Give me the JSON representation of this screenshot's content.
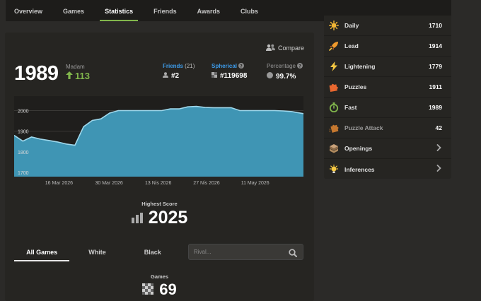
{
  "nav": {
    "tabs": [
      {
        "label": "Overview"
      },
      {
        "label": "Games"
      },
      {
        "label": "Statistics"
      },
      {
        "label": "Friends"
      },
      {
        "label": "Awards"
      },
      {
        "label": "Clubs"
      }
    ],
    "active": "Statistics"
  },
  "summary": {
    "compare_label": "Compare",
    "rating": "1989",
    "title_label": "Madam",
    "delta": "113",
    "friends_label": "Friends",
    "friends_count": "(21)",
    "friends_rank": "#2",
    "global_label": "Spherical",
    "global_rank": "#119698",
    "percentile_label": "Percentage",
    "percentile": "99.7%"
  },
  "chart_data": {
    "type": "area",
    "x_tick_labels": [
      "16 Mar 2026",
      "30 Mar 2026",
      "13 Nis 2026",
      "27 Nis 2026",
      "11 May 2026"
    ],
    "y_tick_labels": [
      "2000",
      "1900",
      "1800",
      "1700"
    ],
    "ylim": [
      1680,
      2070
    ],
    "grid": true,
    "color": "#3f95b4",
    "x": [
      0,
      3,
      6,
      9,
      12,
      15,
      18,
      21,
      24,
      27,
      30,
      33,
      36,
      39,
      42,
      45,
      48,
      51,
      54,
      57,
      60,
      63,
      66,
      69,
      72,
      75,
      78,
      81,
      84,
      87,
      90,
      93,
      96,
      100
    ],
    "values": [
      1880,
      1852,
      1872,
      1862,
      1855,
      1848,
      1838,
      1832,
      1922,
      1952,
      1960,
      1988,
      2000,
      2000,
      2000,
      2000,
      2000,
      2000,
      2008,
      2008,
      2018,
      2020,
      2015,
      2014,
      2014,
      2014,
      2000,
      2000,
      2000,
      2000,
      2000,
      1998,
      1995,
      1985
    ]
  },
  "highest": {
    "label": "Highest Score",
    "value": "2025"
  },
  "game_tabs": [
    {
      "label": "All Games"
    },
    {
      "label": "White"
    },
    {
      "label": "Black"
    }
  ],
  "rival": {
    "placeholder": "Rival..."
  },
  "games": {
    "label": "Games",
    "value": "69"
  },
  "ratings": [
    {
      "name": "Daily",
      "score": "1710",
      "icon": "sun-icon",
      "color": "#f1b534"
    },
    {
      "name": "Lead",
      "score": "1914",
      "icon": "rocket-icon",
      "color": "#f09a2c"
    },
    {
      "name": "Lightening",
      "score": "1779",
      "icon": "lightning-icon",
      "color": "#f5c842"
    },
    {
      "name": "Puzzles",
      "score": "1911",
      "icon": "puzzle-icon",
      "color": "#e8672f"
    },
    {
      "name": "Fast",
      "score": "1989",
      "icon": "timer-icon",
      "color": "#81b64c"
    },
    {
      "name": "Puzzle Attack",
      "score": "42",
      "icon": "puzzle-rush-icon",
      "color": "#c6782f"
    },
    {
      "name": "Openings",
      "score": "",
      "icon": "book-icon",
      "color": "#b08a5e"
    },
    {
      "name": "Inferences",
      "score": "",
      "icon": "lightbulb-icon",
      "color": "#f5c842"
    }
  ]
}
